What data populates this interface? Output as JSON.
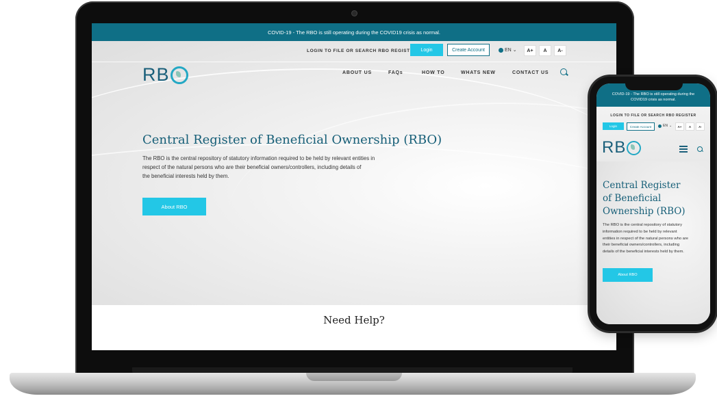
{
  "desktop": {
    "covid_banner": "COVID-19 - The RBO is still operating during the COVID19 crisis as normal.",
    "util_link": "LOGIN TO FILE OR SEARCH RBO REGISTER",
    "login_label": "Login",
    "create_account_label": "Create Account",
    "language": "EN",
    "font_size_buttons": [
      "A+",
      "A",
      "A-"
    ],
    "logo_text": "RB",
    "nav_items": [
      "ABOUT US",
      "FAQs",
      "HOW TO",
      "WHATS NEW",
      "CONTACT US"
    ],
    "hero_title": "Central Register of Beneficial Ownership (RBO)",
    "hero_text_lines": [
      "The RBO is the central repository of statutory information required to be held by relevant entities in",
      "respect of the natural persons who are their beneficial owners/controllers, including details of",
      "the beneficial interests held by them."
    ],
    "hero_button": "About RBO",
    "need_help": "Need Help?"
  },
  "mobile": {
    "covid_banner_lines": [
      "COVID-19 - The RBO is still operating during the",
      "COVID19 crisis as normal."
    ],
    "util_link": "LOGIN TO FILE OR SEARCH RBO REGISTER",
    "login_label": "Login",
    "create_account_label": "Create Account",
    "language": "EN",
    "font_size_buttons": [
      "A+",
      "A",
      "A-"
    ],
    "logo_text": "RB",
    "hero_title_lines": [
      "Central Register",
      "of Beneficial",
      "Ownership (RBO)"
    ],
    "hero_text_lines": [
      "The RBO is the central repository of statutory",
      "information required to be held by relevant",
      "entities in respect of the natural persons who are",
      "their beneficial owners/controllers, including",
      "details of the beneficial interests held by them."
    ],
    "hero_button": "About RBO"
  },
  "colors": {
    "brand_teal": "#0f6f86",
    "accent_cyan": "#23c7e6",
    "title_blue": "#155e77"
  }
}
